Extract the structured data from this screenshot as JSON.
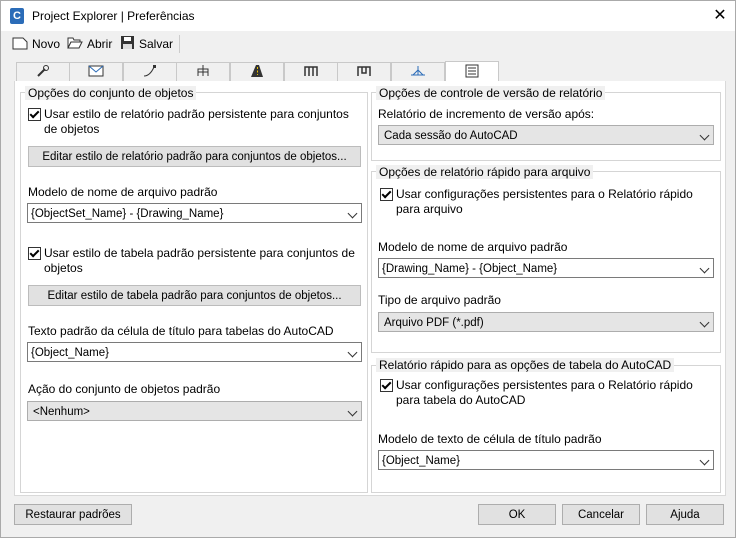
{
  "window": {
    "title": "Project Explorer | Preferências",
    "app_icon_letter": "C",
    "close_glyph": "✕"
  },
  "toolbar": {
    "new_label": "Novo",
    "open_label": "Abrir",
    "save_label": "Salvar"
  },
  "tabs": {
    "icons": [
      "wrench-icon",
      "envelope-icon",
      "curve-icon",
      "structure-icon",
      "road-icon",
      "pipe-icon",
      "pipe-network-icon",
      "survey-icon",
      "report-icon"
    ],
    "active_index": 8
  },
  "left": {
    "object_set_group_title": "Opções do conjunto de objetos",
    "use_report_style_label": "Usar estilo de relatório padrão persistente para conjuntos de objetos",
    "use_report_style_checked": true,
    "edit_report_style_button": "Editar estilo de relatório padrão para conjuntos de objetos...",
    "filename_template_label": "Modelo de nome de arquivo padrão",
    "filename_template_value": "{ObjectSet_Name} - {Drawing_Name}",
    "use_table_style_label": "Usar estilo de tabela padrão persistente para conjuntos de objetos",
    "use_table_style_checked": true,
    "edit_table_style_button": "Editar estilo de tabela padrão para conjuntos de objetos...",
    "title_cell_text_label": "Texto padrão da célula de título para tabelas do AutoCAD",
    "title_cell_text_value": "{Object_Name}",
    "default_action_label": "Ação do conjunto de objetos padrão",
    "default_action_value": "<Nenhum>"
  },
  "right": {
    "version_group_title": "Opções de controle de versão de relatório",
    "increment_label": "Relatório de incremento de versão após:",
    "increment_value": "Cada sessão do AutoCAD",
    "quick_file_group_title": "Opções de relatório rápido para arquivo",
    "quick_file_checkbox_label": "Usar configurações persistentes para o Relatório rápido para arquivo",
    "quick_file_checked": true,
    "quick_filename_label": "Modelo de nome de arquivo padrão",
    "quick_filename_value": "{Drawing_Name} - {Object_Name}",
    "file_type_label": "Tipo de arquivo padrão",
    "file_type_value": "Arquivo PDF (*.pdf)",
    "quick_table_group_title": "Relatório rápido para as opções de tabela do AutoCAD",
    "quick_table_checkbox_label": "Usar configurações persistentes para o Relatório rápido para tabela do AutoCAD",
    "quick_table_checked": true,
    "title_cell_template_label": "Modelo de texto de célula de título padrão",
    "title_cell_template_value": "{Object_Name}"
  },
  "footer": {
    "restore_label": "Restaurar padrões",
    "ok_label": "OK",
    "cancel_label": "Cancelar",
    "help_label": "Ajuda"
  }
}
